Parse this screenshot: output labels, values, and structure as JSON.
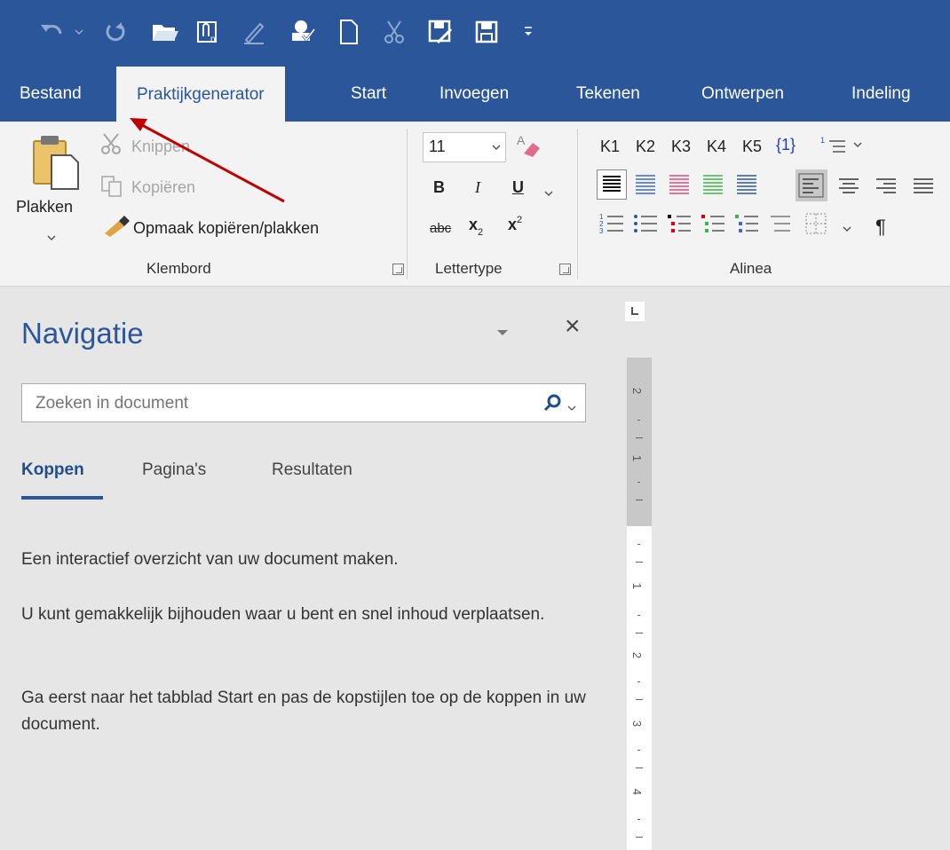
{
  "quick_access": {
    "icons": [
      "undo-icon",
      "redo-icon",
      "open-folder-icon",
      "attach-icon",
      "signature-icon",
      "stamp-icon",
      "new-document-icon",
      "cut-icon",
      "save-as-icon",
      "save-icon",
      "customize-icon"
    ]
  },
  "tabs": {
    "bestand": "Bestand",
    "praktijkgenerator": "Praktijkgenerator",
    "start": "Start",
    "invoegen": "Invoegen",
    "tekenen": "Tekenen",
    "ontwerpen": "Ontwerpen",
    "indeling": "Indeling"
  },
  "ribbon": {
    "clipboard": {
      "paste": "Plakken",
      "cut": "Knippen",
      "copy": "Kopiëren",
      "format_painter": "Opmaak kopiëren/plakken",
      "label": "Klembord"
    },
    "font": {
      "size": "11",
      "bold": "B",
      "italic": "I",
      "underline": "U",
      "strike": "abc",
      "subscript": "x",
      "sub_mark": "2",
      "superscript": "x",
      "sup_mark": "2",
      "label": "Lettertype"
    },
    "paragraph": {
      "styles": [
        "K1",
        "K2",
        "K3",
        "K4",
        "K5"
      ],
      "brace_one": "{1}",
      "pilcrow": "¶",
      "label": "Alinea"
    }
  },
  "nav": {
    "title": "Navigatie",
    "close": "×",
    "search_placeholder": "Zoeken in document",
    "tabs": [
      "Koppen",
      "Pagina's",
      "Resultaten"
    ],
    "para1": "Een interactief overzicht van uw document maken.",
    "para2": "U kunt gemakkelijk bijhouden waar u bent en snel inhoud verplaatsen.",
    "para3": "Ga eerst naar het tabblad Start en pas de kopstijlen toe op de koppen in uw document."
  },
  "ruler": {
    "labels": [
      "2",
      "1",
      "1",
      "2",
      "3",
      "4"
    ]
  },
  "colors": {
    "brand": "#2b579a",
    "annotation_arrow": "#c00000"
  }
}
